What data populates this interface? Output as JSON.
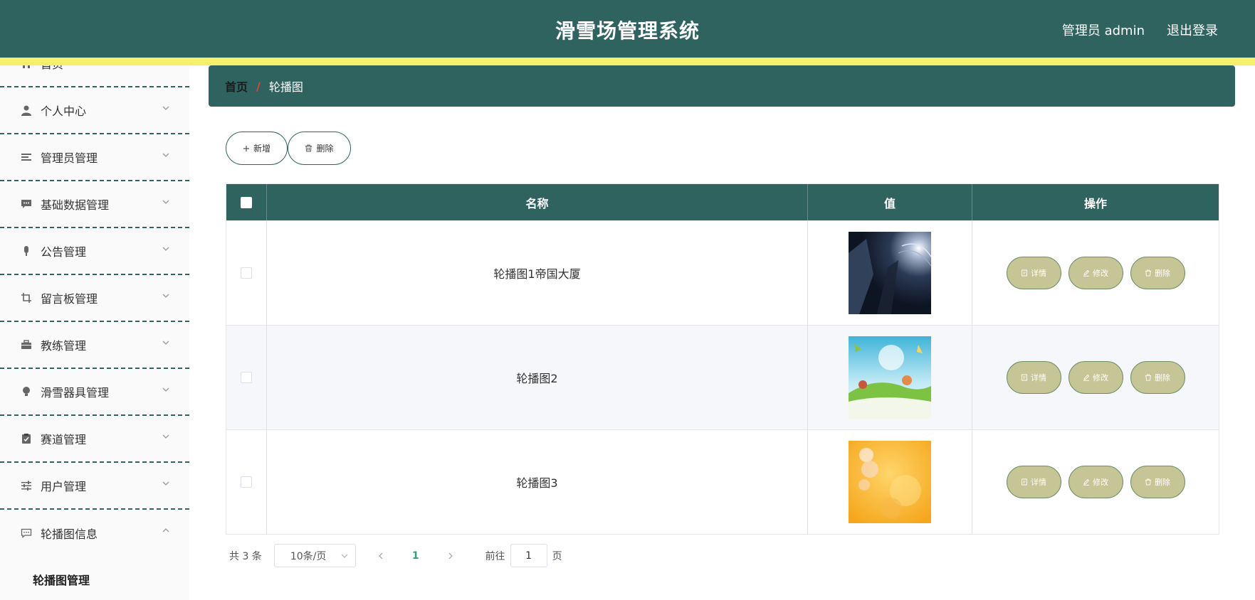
{
  "header": {
    "title": "滑雪场管理系统",
    "user": "管理员 admin",
    "logout": "退出登录"
  },
  "sidebar": {
    "items": [
      {
        "label": "首页",
        "icon": "home-icon"
      },
      {
        "label": "个人中心",
        "icon": "user-icon"
      },
      {
        "label": "管理员管理",
        "icon": "list-icon"
      },
      {
        "label": "基础数据管理",
        "icon": "message-icon"
      },
      {
        "label": "公告管理",
        "icon": "microphone-icon"
      },
      {
        "label": "留言板管理",
        "icon": "crop-icon"
      },
      {
        "label": "教练管理",
        "icon": "briefcase-icon"
      },
      {
        "label": "滑雪器具管理",
        "icon": "lightbulb-icon"
      },
      {
        "label": "赛道管理",
        "icon": "clipboard-check-icon"
      },
      {
        "label": "用户管理",
        "icon": "sliders-icon"
      },
      {
        "label": "轮播图信息",
        "icon": "chat-dots-icon"
      }
    ],
    "sub_item": "轮播图管理"
  },
  "breadcrumb": {
    "home": "首页",
    "separator": "/",
    "current": "轮播图"
  },
  "toolbar": {
    "add_label": "新增",
    "delete_label": "删除"
  },
  "table": {
    "columns": [
      "名称",
      "值",
      "操作"
    ],
    "rows": [
      {
        "name": "轮播图1帝国大厦",
        "image": "dark-space-image"
      },
      {
        "name": "轮播图2",
        "image": "cartoon-meadow-image"
      },
      {
        "name": "轮播图3",
        "image": "yellow-floral-image"
      }
    ],
    "actions": {
      "detail": "详情",
      "edit": "修改",
      "delete": "删除"
    }
  },
  "pagination": {
    "total": "共 3 条",
    "page_size": "10条/页",
    "current_page": "1",
    "goto_prefix": "前往",
    "goto_value": "1",
    "goto_suffix": "页"
  },
  "colors": {
    "primary": "#2f6360",
    "stripe": "#f5f06b",
    "action_button": "#c6c595",
    "page_active": "#2fa079"
  }
}
